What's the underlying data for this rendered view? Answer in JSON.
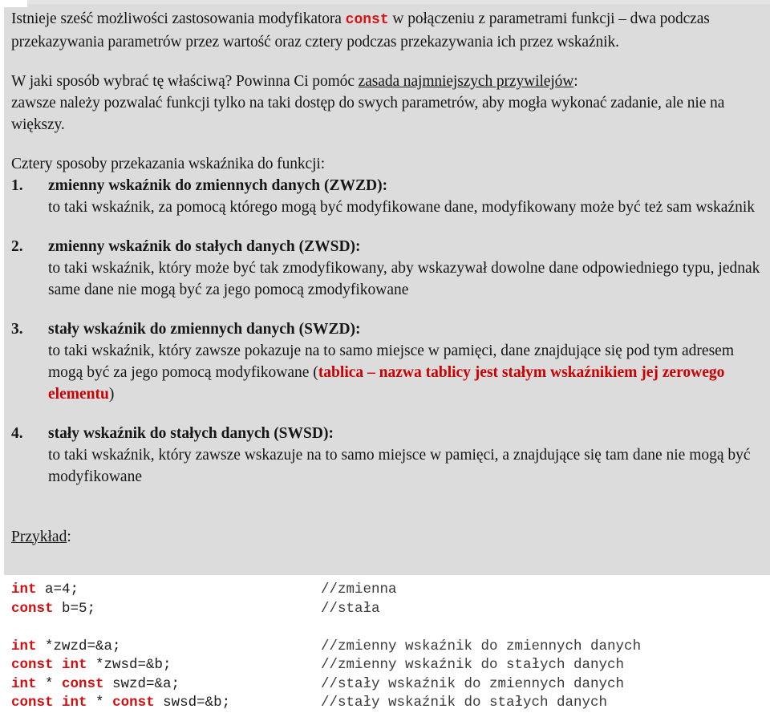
{
  "slide": {
    "background_color": "#dcdcdc",
    "keyword_color": "#d81414",
    "highlight_color": "#cc0000",
    "intro": {
      "line1_a": "Istnieje sześć możliwości zastosowania modyfikatora ",
      "line1_keyword": "const",
      "line1_b": " w połączeniu z parametrami funkcji – dwa podczas przekazywania parametrów przez wartość oraz cztery podczas przekazywania ich przez wskaźnik."
    },
    "advice": {
      "question": "W jaki sposób wybrać tę właściwą? Powinna Ci pomóc ",
      "principle": "zasada najmniejszych przywilejów",
      "colon": ":",
      "detail": "zawsze należy pozwalać funkcji tylko na taki dostęp do swych parametrów, aby mogła wykonać zadanie, ale nie na większy."
    },
    "list_heading": "Cztery sposoby przekazania wskaźnika do funkcji:",
    "items": [
      {
        "number": "1.",
        "title": "zmienny wskaźnik do zmiennych danych (ZWZD):",
        "body": "to taki wskaźnik, za pomocą którego mogą być modyfikowane dane, modyfikowany może być też sam wskaźnik"
      },
      {
        "number": "2.",
        "title": "zmienny wskaźnik do stałych danych (ZWSD):",
        "body": "to taki wskaźnik, który może być tak zmodyfikowany, aby wskazywał dowolne dane odpowiedniego typu, jednak same dane nie mogą być za jego pomocą zmodyfikowane"
      },
      {
        "number": "3.",
        "title": "stały wskaźnik do zmiennych danych (SWZD):",
        "body_a": "to taki wskaźnik, który zawsze pokazuje na to samo miejsce w pamięci, dane znajdujące się pod tym adresem mogą być za jego pomocą modyfikowane (",
        "body_highlight": "tablica – nazwa tablicy jest stałym wskaźnikiem jej zerowego elementu",
        "body_b": ")"
      },
      {
        "number": "4.",
        "title": "stały wskaźnik do stałych danych (SWSD):",
        "body": "to taki wskaźnik, który zawsze wskazuje na to samo miejsce w pamięci, a znajdujące się tam dane nie mogą być modyfikowane"
      }
    ],
    "example_label": {
      "word": "Przykład",
      "colon": ":"
    },
    "code": {
      "lines": [
        {
          "kw1": "int",
          "rest1": " a=4;",
          "kw2": "",
          "rest2": "",
          "kw3": "",
          "rest3": "",
          "comment": "//zmienna"
        },
        {
          "kw1": "const",
          "rest1": " b=5;",
          "kw2": "",
          "rest2": "",
          "kw3": "",
          "rest3": "",
          "comment": "//stała"
        },
        {
          "blank": true
        },
        {
          "kw1": "int",
          "rest1": " *zwzd=&a;",
          "kw2": "",
          "rest2": "",
          "kw3": "",
          "rest3": "",
          "comment": "//zmienny wskaźnik do zmiennych danych"
        },
        {
          "kw1": "const",
          "rest1": " ",
          "kw2": "int",
          "rest2": " *zwsd=&b;",
          "kw3": "",
          "rest3": "",
          "comment": "//zmienny wskaźnik do stałych danych"
        },
        {
          "kw1": "int",
          "rest1": " * ",
          "kw2": "const",
          "rest2": " swzd=&a;",
          "kw3": "",
          "rest3": "",
          "comment": "//stały wskaźnik do zmiennych danych"
        },
        {
          "kw1": "const",
          "rest1": " ",
          "kw2": "int",
          "rest2": " * ",
          "kw3": "const",
          "rest3": " swsd=&b;",
          "comment": "//stały wskaźnik do stałych danych"
        }
      ]
    }
  }
}
